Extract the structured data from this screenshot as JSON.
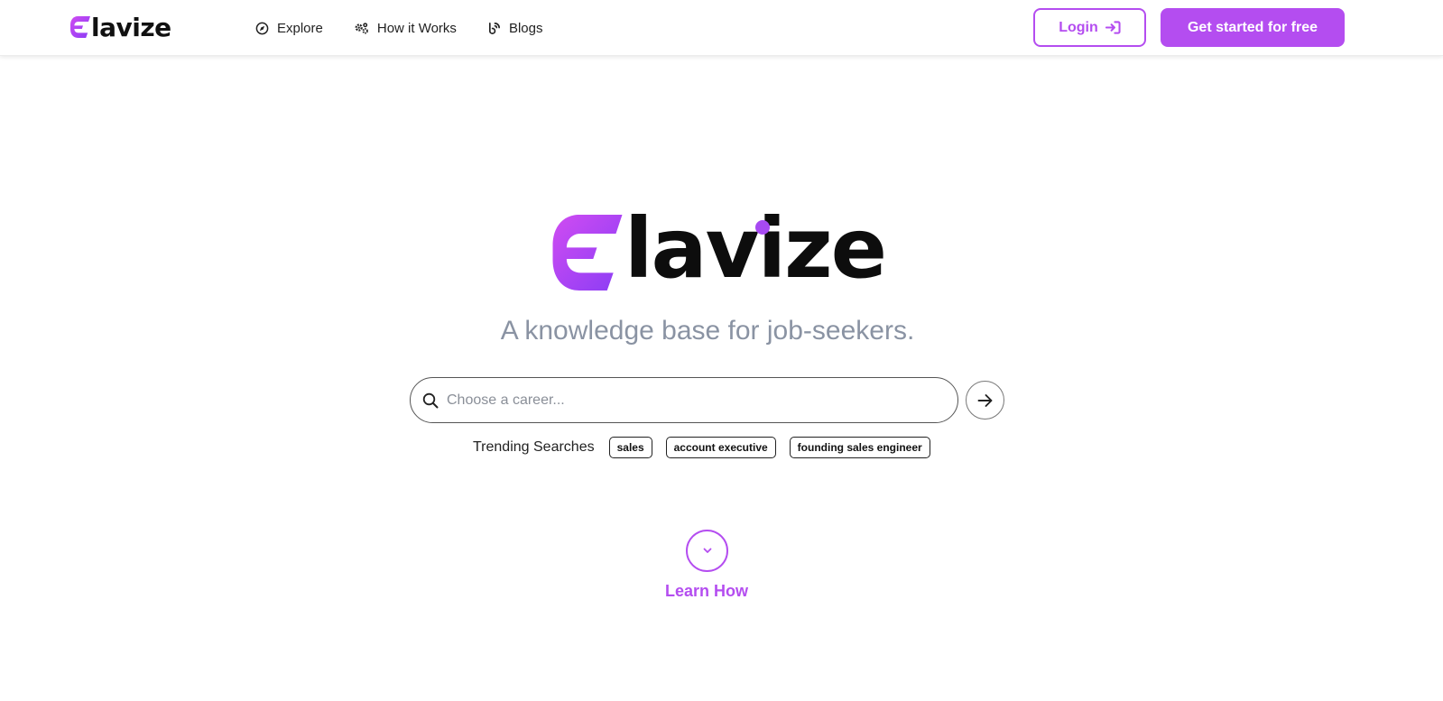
{
  "brand": {
    "name_rest": "lavize",
    "accent": "#b44df0",
    "logo_icon": "elavize-e-logo-icon"
  },
  "header": {
    "nav": [
      {
        "label": "Explore",
        "icon": "compass-icon"
      },
      {
        "label": "How it Works",
        "icon": "gears-icon"
      },
      {
        "label": "Blogs",
        "icon": "blog-icon"
      }
    ],
    "login_label": "Login",
    "login_icon": "sign-in-icon",
    "cta_label": "Get started for free"
  },
  "hero": {
    "tagline": "A knowledge base for job-seekers.",
    "search": {
      "placeholder": "Choose a career...",
      "value": ""
    },
    "trending_label": "Trending Searches",
    "trending": [
      "sales",
      "account executive",
      "founding sales engineer"
    ],
    "learn_label": "Learn How"
  }
}
